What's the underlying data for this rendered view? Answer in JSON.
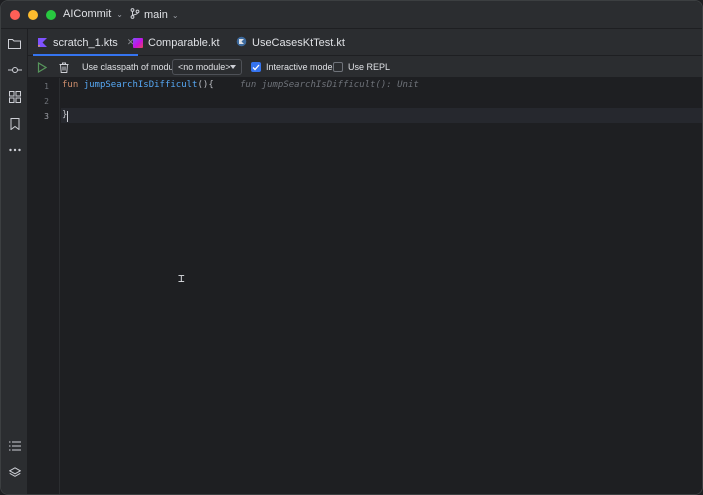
{
  "titlebar": {
    "project": "AICommit",
    "branch": "main"
  },
  "tabs": [
    {
      "label": "scratch_1.kts",
      "active": true
    },
    {
      "label": "Comparable.kt",
      "active": false
    },
    {
      "label": "UseCasesKtTest.kt",
      "active": false
    }
  ],
  "scratch_toolbar": {
    "classpath_label": "Use classpath of module",
    "module_value": "<no module>",
    "interactive_mode_label": "Interactive mode",
    "interactive_mode_checked": true,
    "use_repl_label": "Use REPL",
    "use_repl_checked": false
  },
  "editor": {
    "line_numbers": [
      "1",
      "2",
      "3"
    ],
    "code_keyword": "fun",
    "code_function": "jumpSearchIsDifficult",
    "code_parens": "()",
    "code_open_brace": "{",
    "code_close_brace": "}",
    "inlay_hint": "fun jumpSearchIsDifficult(): Unit"
  },
  "colors": {
    "accent": "#3574f0",
    "keyword": "#cf8e6d",
    "function": "#56a8f5",
    "background": "#1e1f22",
    "panel": "#2b2d30"
  }
}
